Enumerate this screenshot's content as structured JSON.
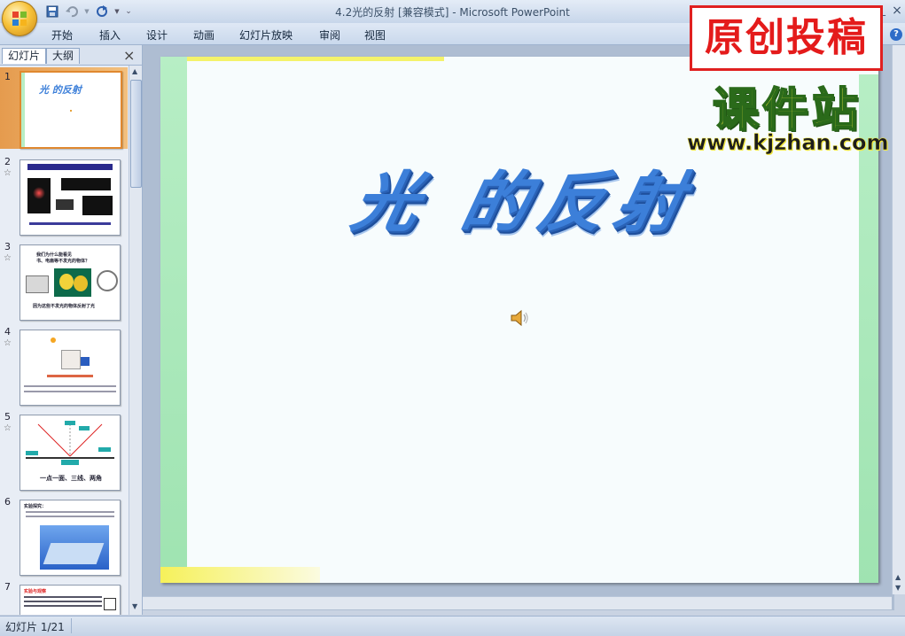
{
  "window": {
    "title": "4.2光的反射 [兼容模式] - Microsoft PowerPoint"
  },
  "ribbon": {
    "tabs": [
      "开始",
      "插入",
      "设计",
      "动画",
      "幻灯片放映",
      "审阅",
      "视图"
    ]
  },
  "panel": {
    "tab_slides": "幻灯片",
    "tab_outline": "大纲",
    "slide_numbers": [
      "1",
      "2",
      "3",
      "4",
      "5",
      "6",
      "7"
    ]
  },
  "thumbnails": {
    "t1_title": "光 的反射",
    "t3_line1": "我们为什么能看见",
    "t3_line2": "书、电扇等不发光的物体？",
    "t3_caption": "因为这些不发光的物体反射了光",
    "t5_caption": "一点一面、三线、两角",
    "t6_line1": "实验探究：",
    "t7_line1": "实验与观察"
  },
  "slide": {
    "title": "光 的反射"
  },
  "watermark": {
    "stamp": "原创投稿",
    "logo": "课件站",
    "url": "www.kjzhan.com"
  },
  "status": {
    "slide_counter": "幻灯片 1/21"
  },
  "colors": {
    "title_blue": "#3c7fd9",
    "stamp_red": "#e41b1b",
    "logo_yellow": "#e8e23a",
    "slide_border_green": "#9fe3b1"
  }
}
